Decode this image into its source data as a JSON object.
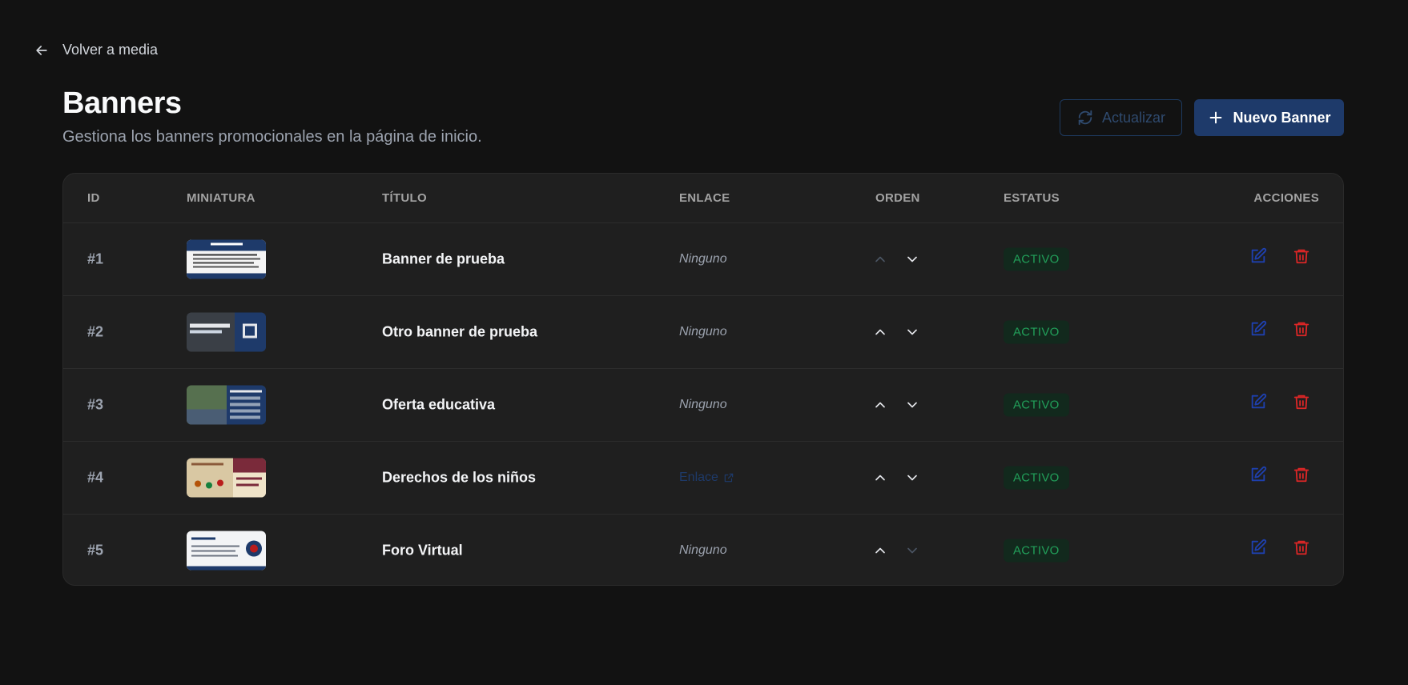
{
  "nav": {
    "back_label": "Volver a media"
  },
  "header": {
    "title": "Banners",
    "subtitle": "Gestiona los banners promocionales en la página de inicio."
  },
  "toolbar": {
    "refresh_label": "Actualizar",
    "new_label": "Nuevo Banner"
  },
  "table": {
    "columns": [
      "ID",
      "MINIATURA",
      "TÍTULO",
      "ENLACE",
      "ORDEN",
      "ESTATUS",
      "ACCIONES"
    ],
    "rows": [
      {
        "id": "#1",
        "title": "Banner de prueba",
        "link": "Ninguno",
        "has_link": false,
        "status": "ACTIVO",
        "can_move_up": false,
        "can_move_down": true
      },
      {
        "id": "#2",
        "title": "Otro banner de prueba",
        "link": "Ninguno",
        "has_link": false,
        "status": "ACTIVO",
        "can_move_up": true,
        "can_move_down": true
      },
      {
        "id": "#3",
        "title": "Oferta educativa",
        "link": "Ninguno",
        "has_link": false,
        "status": "ACTIVO",
        "can_move_up": true,
        "can_move_down": true
      },
      {
        "id": "#4",
        "title": "Derechos de los niños",
        "link": "Enlace",
        "has_link": true,
        "status": "ACTIVO",
        "can_move_up": true,
        "can_move_down": true
      },
      {
        "id": "#5",
        "title": "Foro Virtual",
        "link": "Ninguno",
        "has_link": false,
        "status": "ACTIVO",
        "can_move_up": true,
        "can_move_down": false
      }
    ]
  },
  "colors": {
    "background": "#121212",
    "surface": "#1f1f1f",
    "accent": "#1e3a6a",
    "status_active_text": "#22a05a",
    "status_active_bg": "#12291d",
    "delete": "#dc2626",
    "edit": "#1e40af"
  },
  "icons": {
    "back": "arrow-left-icon",
    "refresh": "refresh-icon",
    "new": "plus-icon",
    "order_up": "chevron-up-icon",
    "order_down": "chevron-down-icon",
    "edit": "edit-icon",
    "delete": "trash-icon",
    "external": "external-link-icon"
  }
}
